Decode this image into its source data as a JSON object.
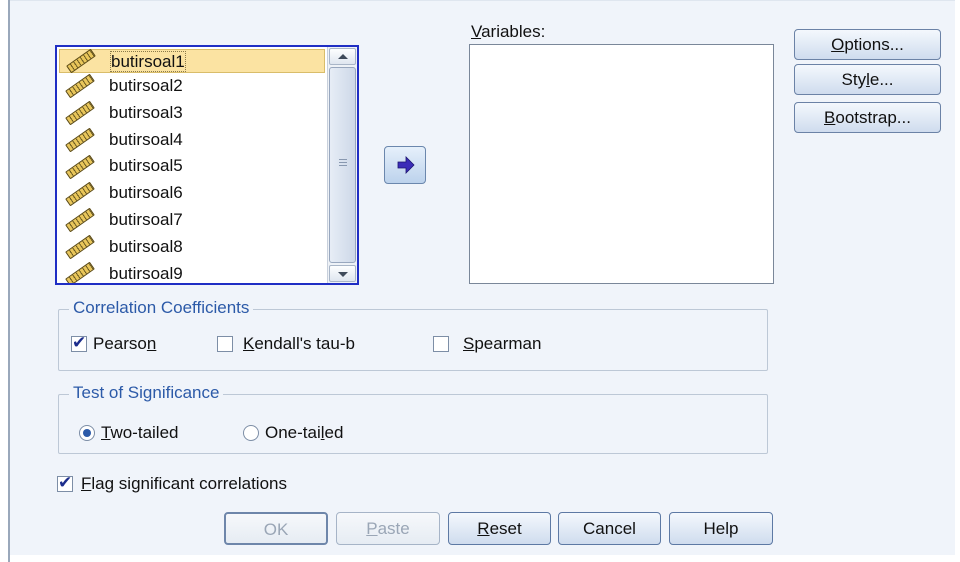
{
  "source_list": {
    "items": [
      {
        "label": "butirsoal1",
        "selected": true
      },
      {
        "label": "butirsoal2"
      },
      {
        "label": "butirsoal3"
      },
      {
        "label": "butirsoal4"
      },
      {
        "label": "butirsoal5"
      },
      {
        "label": "butirsoal6"
      },
      {
        "label": "butirsoal7"
      },
      {
        "label": "butirsoal8"
      },
      {
        "label": "butirsoal9"
      }
    ]
  },
  "target": {
    "label_pre": "",
    "label_key": "V",
    "label_post": "ariables:"
  },
  "side_buttons": {
    "options": {
      "key": "O",
      "post": "ptions..."
    },
    "style": {
      "pre": "Sty",
      "key": "l",
      "post": "e..."
    },
    "bootstrap": {
      "key": "B",
      "post": "ootstrap..."
    }
  },
  "correlation": {
    "title": "Correlation Coefficients",
    "pearson": {
      "pre": "Pearso",
      "key": "n",
      "post": "",
      "checked": true
    },
    "kendall": {
      "pre": "",
      "key": "K",
      "post": "endall's tau-b",
      "checked": false
    },
    "spearman": {
      "pre": "",
      "key": "S",
      "post": "pearman",
      "checked": false
    }
  },
  "significance": {
    "title": "Test of Significance",
    "two_tailed": {
      "pre": "",
      "key": "T",
      "post": "wo-tailed",
      "checked": true
    },
    "one_tailed": {
      "pre": "One-tai",
      "key": "l",
      "post": "ed",
      "checked": false
    }
  },
  "flag": {
    "pre": "",
    "key": "F",
    "post": "lag significant correlations",
    "checked": true
  },
  "buttons": {
    "ok": "OK",
    "paste": {
      "key": "P",
      "post": "aste"
    },
    "reset": {
      "key": "R",
      "post": "eset"
    },
    "cancel": "Cancel",
    "help": "Help"
  },
  "colors": {
    "accent": "#2c5aa8",
    "list_border": "#1f2ec4",
    "selection": "#fbe3a2"
  }
}
